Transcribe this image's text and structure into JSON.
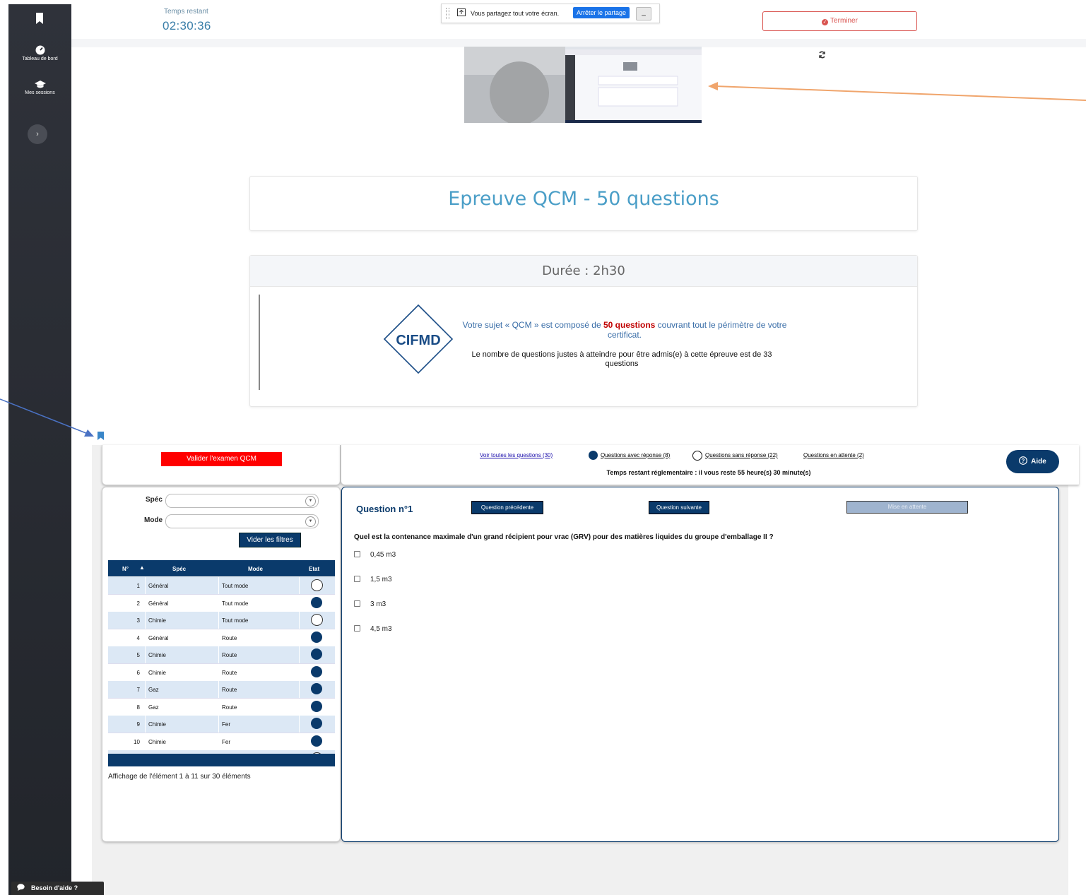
{
  "sidebar": {
    "items": [
      {
        "label": "Tableau de bord",
        "icon": "dashboard-icon"
      },
      {
        "label": "Mes sessions",
        "icon": "graduation-cap-icon"
      }
    ],
    "toggle": "›"
  },
  "header": {
    "timer_label": "Temps restant",
    "timer_value": "02:30:36",
    "finish_label": "Terminer"
  },
  "share_bar": {
    "message": "Vous partagez tout votre écran.",
    "stop_label": "Arrêter le partage",
    "hide_label": "_"
  },
  "exam": {
    "title": "Epreuve QCM - 50 questions",
    "duration": "Durée : 2h30",
    "logo_text": "CIFMD",
    "desc_part1": "Votre sujet « QCM » est composé de ",
    "desc_bold": "50 questions",
    "desc_part2": " couvrant tout le périmètre de votre certificat.",
    "threshold_text": "Le nombre de questions justes à atteindre pour être admis(e) à cette épreuve est de 33 questions"
  },
  "toolbar": {
    "validate_label": "Valider l'examen QCM",
    "filter_all": "Voir toutes les questions (30)",
    "filter_answered": "Questions avec réponse (8)",
    "filter_unanswered": "Questions sans réponse (22)",
    "filter_pending": "Questions en attente (2)",
    "regulatory_time": "Temps restant réglementaire : il vous reste 55 heure(s) 30 minute(s)",
    "help_label": "Aide"
  },
  "filters": {
    "spec_label": "Spéc",
    "mode_label": "Mode",
    "clear_label": "Vider les filtres"
  },
  "table": {
    "columns": [
      "N°",
      "Spéc",
      "Mode",
      "Etat"
    ],
    "sort_indicator": "▲",
    "rows": [
      {
        "n": "1",
        "spec": "Général",
        "mode": "Tout mode",
        "answered": false
      },
      {
        "n": "2",
        "spec": "Général",
        "mode": "Tout mode",
        "answered": true
      },
      {
        "n": "3",
        "spec": "Chimie",
        "mode": "Tout mode",
        "answered": false
      },
      {
        "n": "4",
        "spec": "Général",
        "mode": "Route",
        "answered": true
      },
      {
        "n": "5",
        "spec": "Chimie",
        "mode": "Route",
        "answered": true
      },
      {
        "n": "6",
        "spec": "Chimie",
        "mode": "Route",
        "answered": true
      },
      {
        "n": "7",
        "spec": "Gaz",
        "mode": "Route",
        "answered": true
      },
      {
        "n": "8",
        "spec": "Gaz",
        "mode": "Route",
        "answered": true
      },
      {
        "n": "9",
        "spec": "Chimie",
        "mode": "Fer",
        "answered": true
      },
      {
        "n": "10",
        "spec": "Chimie",
        "mode": "Fer",
        "answered": true
      }
    ],
    "page_info": "Affichage de l'élément 1 à 11 sur 30 éléments"
  },
  "question": {
    "number_label": "Question n°1",
    "prev_label": "Question précédente",
    "next_label": "Question suivante",
    "pending_label": "Mise en attente",
    "text": "Quel est la contenance maximale d'un grand récipient pour vrac (GRV) pour des matières liquides du groupe d'emballage II ?",
    "options": [
      "0,45 m3",
      "1,5 m3",
      "3 m3",
      "4,5 m3"
    ]
  },
  "help_tab": {
    "label": "Besoin d'aide ?"
  },
  "colors": {
    "navy": "#0a3a6b",
    "accent_blue": "#4a9ec7",
    "danger": "#d9534f",
    "validate_red": "#ff0000"
  }
}
